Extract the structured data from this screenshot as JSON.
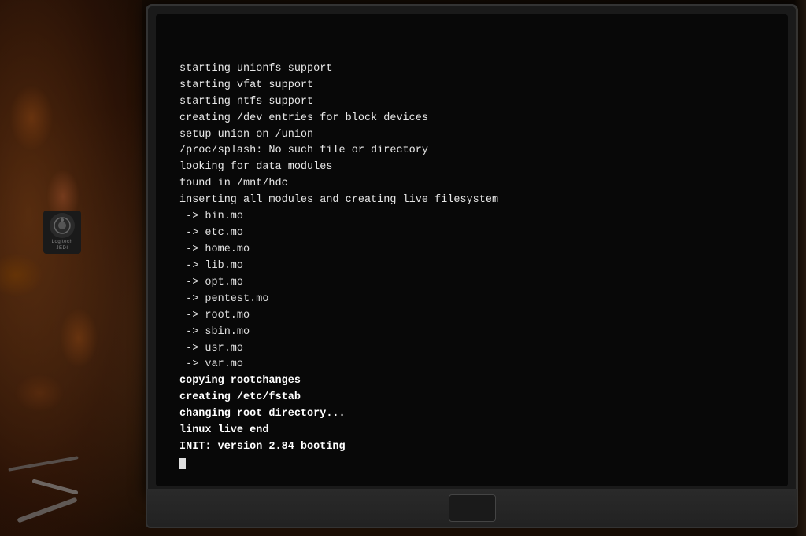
{
  "scene": {
    "background_color": "#1a0a04",
    "description": "Laptop showing Linux live boot terminal output"
  },
  "logitech": {
    "brand": "Logitech",
    "model": "JEDI"
  },
  "terminal": {
    "lines": [
      "starting unionfs support",
      "starting vfat support",
      "starting ntfs support",
      "creating /dev entries for block devices",
      "setup union on /union",
      "/proc/splash: No such file or directory",
      "looking for data modules",
      "found in /mnt/hdc",
      "inserting all modules and creating live filesystem",
      " -> bin.mo",
      " -> etc.mo",
      " -> home.mo",
      " -> lib.mo",
      " -> opt.mo",
      " -> pentest.mo",
      " -> root.mo",
      " -> sbin.mo",
      " -> usr.mo",
      " -> var.mo",
      "copying rootchanges",
      "creating /etc/fstab",
      "changing root directory...",
      "linux live end",
      "INIT: version 2.84 booting",
      "_"
    ],
    "bold_start_index": 19
  }
}
